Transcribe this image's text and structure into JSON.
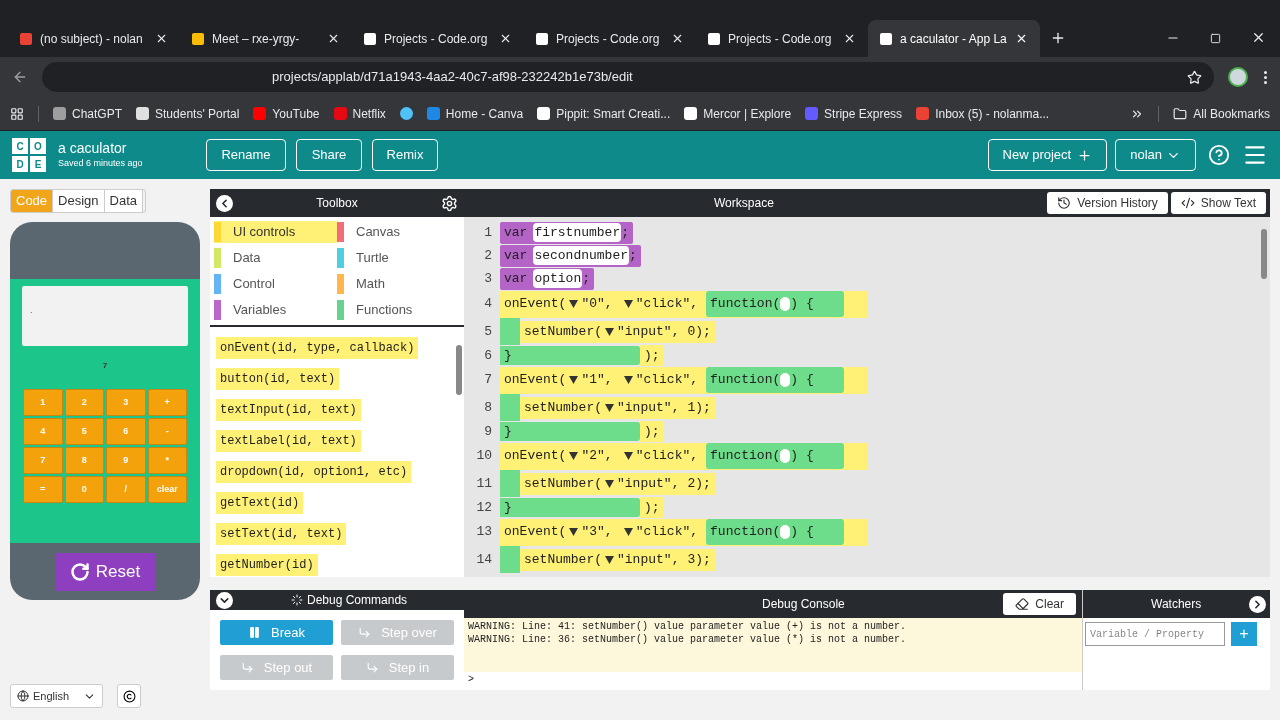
{
  "browser": {
    "tabs": [
      {
        "title": "(no subject) - nolan",
        "color": "#ea4335",
        "selected": false
      },
      {
        "title": "Meet – rxe-yrgy-",
        "color": "#fbbc04",
        "selected": false
      },
      {
        "title": "Projects - Code.org",
        "color": "#ffffff",
        "selected": false
      },
      {
        "title": "Projects - Code.org",
        "color": "#ffffff",
        "selected": false
      },
      {
        "title": "Projects - Code.org",
        "color": "#ffffff",
        "selected": false
      },
      {
        "title": "a caculator - App La",
        "color": "#ffffff",
        "selected": true
      }
    ],
    "url": "projects/applab/d71a1943-4aa2-40c7-af98-232242b1e73b/edit",
    "bookmarks": [
      {
        "label": "ChatGPT",
        "color": "#9e9e9e"
      },
      {
        "label": "Students' Portal",
        "color": "#e0e0e0"
      },
      {
        "label": "YouTube",
        "color": "#ff0000"
      },
      {
        "label": "Netflix",
        "color": "#e50914"
      },
      {
        "color": "#4fc3f7"
      },
      {
        "label": "Home - Canva",
        "color": "#1e88e5"
      },
      {
        "label": "Pippit: Smart Creati...",
        "color": "#ffffff"
      },
      {
        "label": "Mercor | Explore",
        "color": "#ffffff"
      },
      {
        "label": "Stripe Express",
        "color": "#635bff"
      },
      {
        "label": "Inbox (5) - nolanma...",
        "color": "#ea4335"
      }
    ],
    "all_bookmarks": "All Bookmarks"
  },
  "header": {
    "logo": [
      "C",
      "O",
      "D",
      "E"
    ],
    "project": "a caculator",
    "saved": "Saved 6 minutes ago",
    "buttons": [
      "Rename",
      "Share",
      "Remix"
    ],
    "new_project": "New project",
    "user": "nolan"
  },
  "mode_tabs": [
    {
      "label": "Code",
      "selected": true
    },
    {
      "label": "Design",
      "selected": false
    },
    {
      "label": "Data",
      "selected": false
    }
  ],
  "app": {
    "display": ".",
    "label": "7",
    "keys": [
      "1",
      "2",
      "3",
      "+",
      "4",
      "5",
      "6",
      "-",
      "7",
      "8",
      "9",
      "*",
      "=",
      "0",
      "/",
      "clear"
    ],
    "reset": "Reset"
  },
  "language": "English",
  "toolbox": {
    "title": "Toolbox",
    "categories": [
      {
        "label": "UI controls",
        "color": "#fdd835",
        "selected": true
      },
      {
        "label": "Canvas",
        "color": "#f16d7e",
        "selected": false
      },
      {
        "label": "Data",
        "color": "#d3e965",
        "selected": false
      },
      {
        "label": "Turtle",
        "color": "#4dd0e1",
        "selected": false
      },
      {
        "label": "Control",
        "color": "#64b5f6",
        "selected": false
      },
      {
        "label": "Math",
        "color": "#ffb74d",
        "selected": false
      },
      {
        "label": "Variables",
        "color": "#b968c7",
        "selected": false
      },
      {
        "label": "Functions",
        "color": "#68d391",
        "selected": false
      }
    ],
    "blocks": [
      "onEvent(id, type, callback)",
      "button(id, text)",
      "textInput(id, text)",
      "textLabel(id, text)",
      "dropdown(id, option1, etc)",
      "getText(id)",
      "setText(id, text)",
      "getNumber(id)"
    ]
  },
  "workspace": {
    "title": "Workspace",
    "version_history": "Version History",
    "show_text": "Show Text",
    "lines": [
      {
        "n": "1",
        "kind": "var",
        "keyword": "var",
        "name": "firstnumber",
        "end": ";"
      },
      {
        "n": "2",
        "kind": "var",
        "keyword": "var",
        "name": "secondnumber",
        "end": ";"
      },
      {
        "n": "3",
        "kind": "var",
        "keyword": "var",
        "name": "option",
        "end": ";"
      },
      {
        "n": "4",
        "kind": "event",
        "head": "onEvent(",
        "id": "\"0\"",
        "sep": ",",
        "event": "\"click\"",
        "sep2": ",",
        "fn": "function(",
        "fn_end": ") {"
      },
      {
        "n": "5",
        "kind": "call",
        "head": "setNumber(",
        "id": "\"input\"",
        "sep": ",",
        "value": "0",
        "end": ");"
      },
      {
        "n": "6",
        "kind": "end",
        "brace": "}",
        "end": ");"
      },
      {
        "n": "7",
        "kind": "event",
        "head": "onEvent(",
        "id": "\"1\"",
        "sep": ",",
        "event": "\"click\"",
        "sep2": ",",
        "fn": "function(",
        "fn_end": ") {"
      },
      {
        "n": "8",
        "kind": "call",
        "head": "setNumber(",
        "id": "\"input\"",
        "sep": ",",
        "value": "1",
        "end": ");"
      },
      {
        "n": "9",
        "kind": "end",
        "brace": "}",
        "end": ");"
      },
      {
        "n": "10",
        "kind": "event",
        "head": "onEvent(",
        "id": "\"2\"",
        "sep": ",",
        "event": "\"click\"",
        "sep2": ",",
        "fn": "function(",
        "fn_end": ") {"
      },
      {
        "n": "11",
        "kind": "call",
        "head": "setNumber(",
        "id": "\"input\"",
        "sep": ",",
        "value": "2",
        "end": ");"
      },
      {
        "n": "12",
        "kind": "end",
        "brace": "}",
        "end": ");"
      },
      {
        "n": "13",
        "kind": "event",
        "head": "onEvent(",
        "id": "\"3\"",
        "sep": ",",
        "event": "\"click\"",
        "sep2": ",",
        "fn": "function(",
        "fn_end": ") {"
      },
      {
        "n": "14",
        "kind": "call",
        "head": "setNumber(",
        "id": "\"input\"",
        "sep": ",",
        "value": "3",
        "end": ");"
      }
    ]
  },
  "debug": {
    "commands_title": "Debug Commands",
    "commands": [
      {
        "label": "Break",
        "disabled": false
      },
      {
        "label": "Step over",
        "disabled": true
      },
      {
        "label": "Step out",
        "disabled": true
      },
      {
        "label": "Step in",
        "disabled": true
      }
    ],
    "console_title": "Debug Console",
    "clear": "Clear",
    "log": [
      "WARNING: Line: 41: setNumber() value parameter value (+) is not a number.",
      "WARNING: Line: 36: setNumber() value parameter value (*) is not a number."
    ],
    "prompt": ">",
    "watchers_title": "Watchers",
    "watcher_placeholder": "Variable / Property",
    "add": "+"
  }
}
